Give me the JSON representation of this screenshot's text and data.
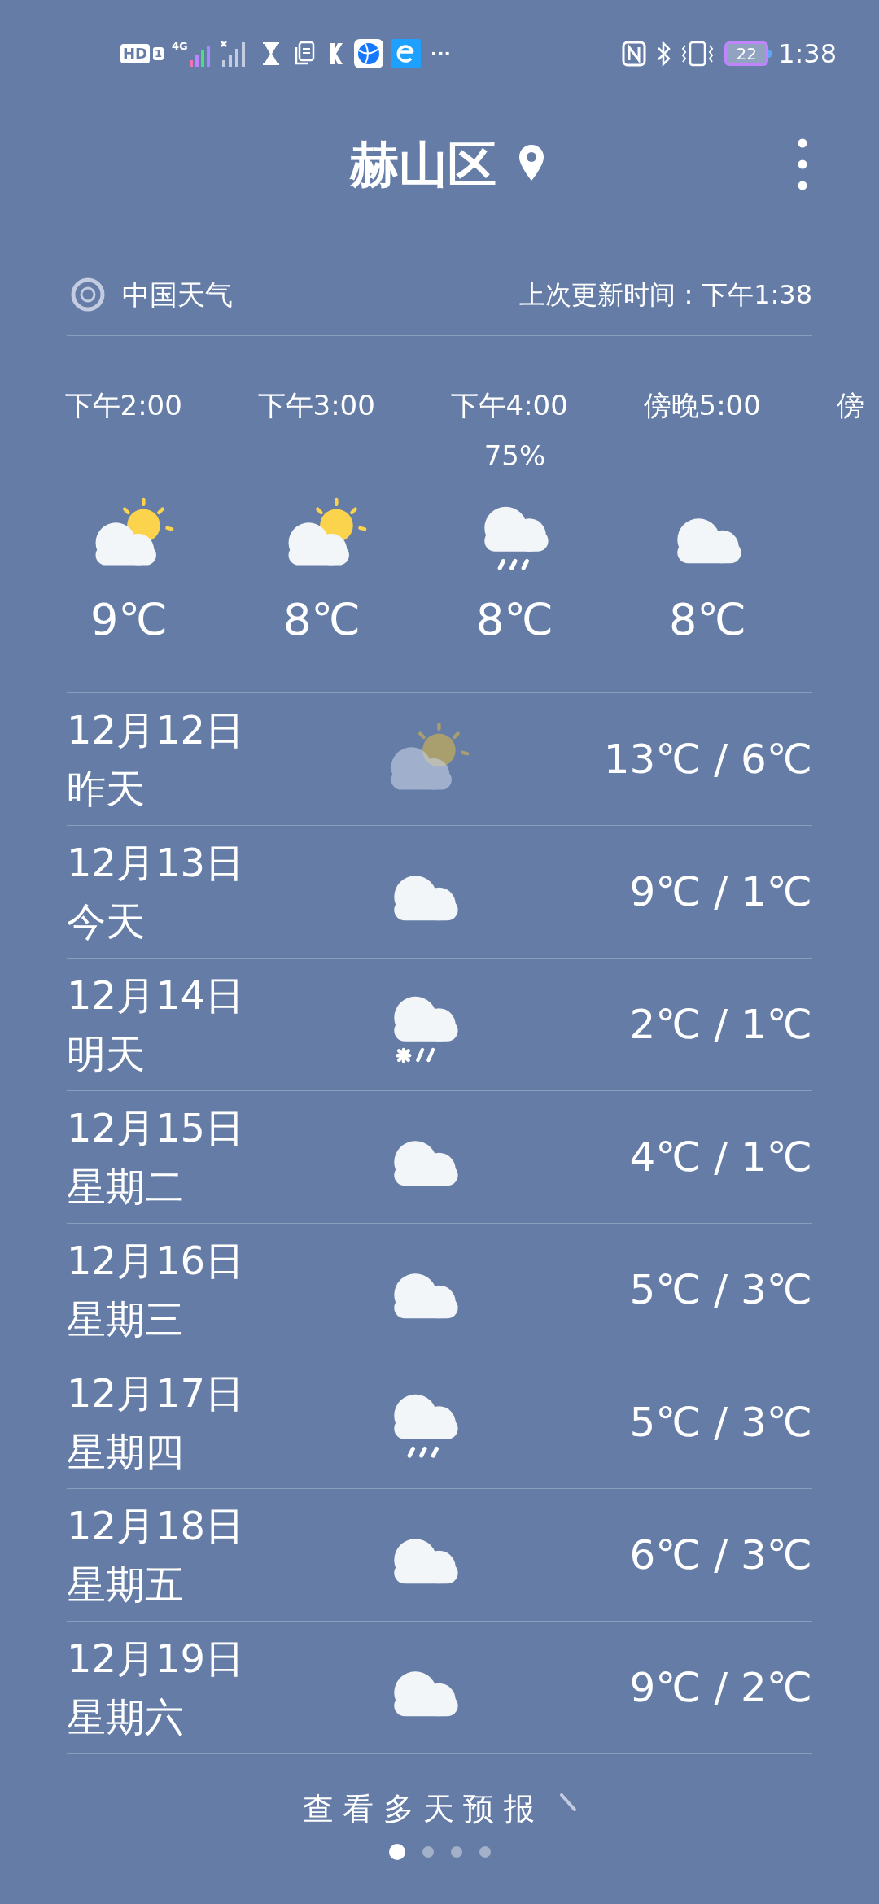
{
  "status_bar": {
    "hd": "HD",
    "sim": "1",
    "network": "4G",
    "more": "···",
    "battery": "22",
    "time": "1:38"
  },
  "header": {
    "title": "赫山区"
  },
  "source": {
    "name": "中国天气",
    "updated": "上次更新时间：下午1:38"
  },
  "hourly": [
    {
      "time": "下午2:00",
      "kind": "sun_cloud",
      "temp": "9℃"
    },
    {
      "time": "下午3:00",
      "kind": "sun_cloud",
      "temp": "8℃"
    },
    {
      "time": "下午4:00",
      "precip": "75%",
      "kind": "rain",
      "temp": "8℃"
    },
    {
      "time": "傍晚5:00",
      "kind": "cloud",
      "temp": "8℃"
    },
    {
      "time": "傍"
    }
  ],
  "daily": [
    {
      "date": "12月12日",
      "day": "昨天",
      "kind": "sun_cloud",
      "dimmed": true,
      "temps": "13℃ / 6℃"
    },
    {
      "date": "12月13日",
      "day": "今天",
      "kind": "cloud",
      "dimmed": false,
      "temps": "9℃ / 1℃"
    },
    {
      "date": "12月14日",
      "day": "明天",
      "kind": "sleet",
      "dimmed": false,
      "temps": "2℃ / 1℃"
    },
    {
      "date": "12月15日",
      "day": "星期二",
      "kind": "cloud",
      "dimmed": false,
      "temps": "4℃ / 1℃"
    },
    {
      "date": "12月16日",
      "day": "星期三",
      "kind": "cloud",
      "dimmed": false,
      "temps": "5℃ / 3℃"
    },
    {
      "date": "12月17日",
      "day": "星期四",
      "kind": "rain",
      "dimmed": false,
      "temps": "5℃ / 3℃"
    },
    {
      "date": "12月18日",
      "day": "星期五",
      "kind": "cloud",
      "dimmed": false,
      "temps": "6℃ / 3℃"
    },
    {
      "date": "12月19日",
      "day": "星期六",
      "kind": "cloud",
      "dimmed": false,
      "temps": "9℃ / 2℃"
    }
  ],
  "more_link": "查看多天预报",
  "pages": [
    {
      "selected": true
    },
    {
      "selected": false
    },
    {
      "selected": false
    },
    {
      "selected": false
    }
  ]
}
